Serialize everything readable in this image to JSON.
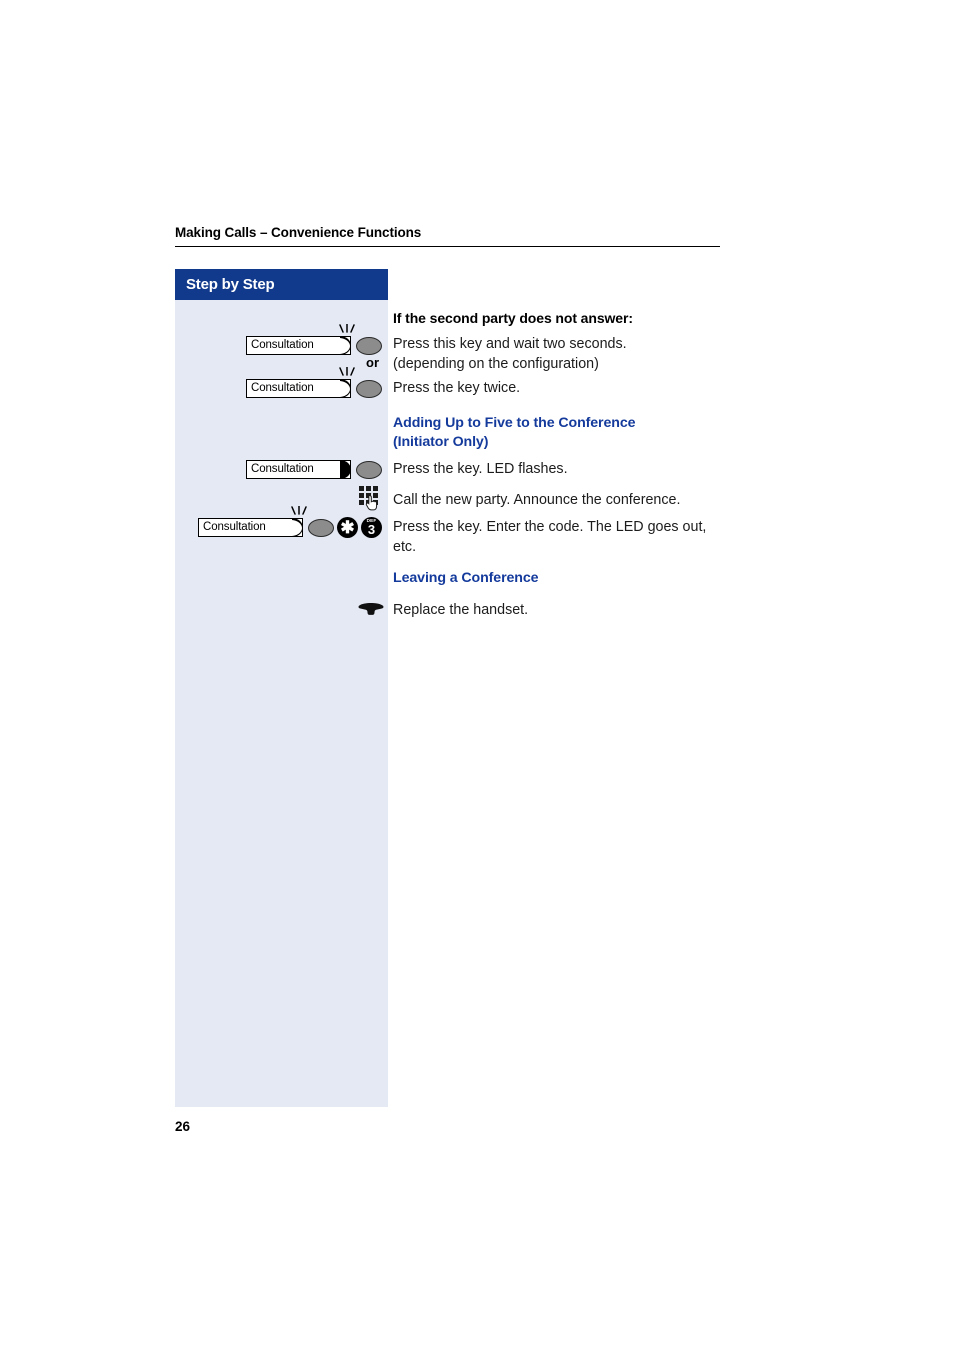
{
  "page": {
    "running_header": "Making Calls – Convenience Functions",
    "page_number": "26",
    "colors": {
      "sidebar_header_bg": "#123a8c",
      "sidebar_body_bg": "#e4e9f4",
      "heading_blue": "#143a9c",
      "key_oval_gray": "#8c8c8c",
      "text_black": "#1c1c1c"
    }
  },
  "sidebar": {
    "title": "Step by Step"
  },
  "content": {
    "heading_black_1": "If the second party does not answer:",
    "step_1": {
      "key_label": "Consultation",
      "text_line_1": "Press this key and wait two seconds.",
      "text_line_2": "(depending on the configuration)",
      "led_state": "flashing"
    },
    "or_label": "or",
    "step_2": {
      "key_label": "Consultation",
      "text": "Press the key twice.",
      "led_state": "flashing"
    },
    "heading_blue_1_line_1": "Adding Up to Five to the Conference",
    "heading_blue_1_line_2": "(Initiator Only)",
    "step_3": {
      "key_label": "Consultation",
      "text": "Press the key. LED flashes.",
      "led_state": "solid"
    },
    "step_4": {
      "icon": "keypad-icon",
      "text": "Call the new party. Announce the conference."
    },
    "step_5": {
      "key_label": "Consultation",
      "led_state": "flashing",
      "code_keys": [
        {
          "sub": "",
          "main": "✱",
          "name": "star-key"
        },
        {
          "sub": "DEF",
          "main": "3",
          "name": "three-key"
        }
      ],
      "text_line_1": "Press the key. Enter the code. The LED goes out,",
      "text_line_2": "etc."
    },
    "heading_blue_2": "Leaving a Conference",
    "step_6": {
      "icon": "handset-icon",
      "text": "Replace the handset."
    }
  }
}
